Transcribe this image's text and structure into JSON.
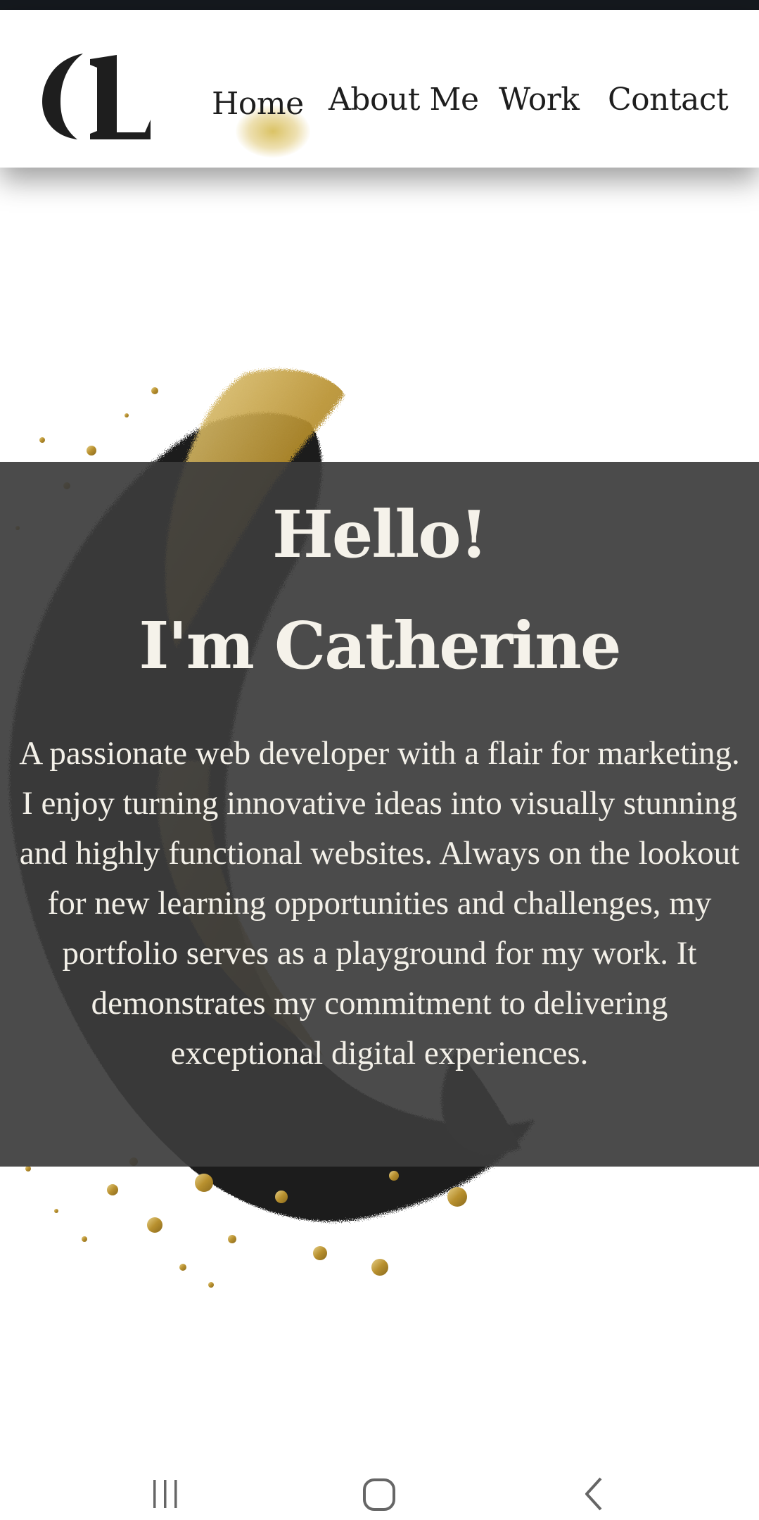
{
  "header": {
    "logo_text": "CL",
    "nav": {
      "home": "Home",
      "about": "About Me",
      "work": "Work",
      "contact": "Contact"
    },
    "active_item": "Home",
    "accent_color": "#d4b84a"
  },
  "hero": {
    "title_line1": "Hello!",
    "title_line2": "I'm Catherine",
    "description": "A passionate web developer with a flair for marketing. I enjoy turning innovative ideas into visually stunning and highly functional websites. Always on the lookout for new learning opportunities and challenges, my portfolio serves as a playground for my work. It demonstrates my commitment to delivering exceptional digital experiences."
  },
  "system_nav": {
    "buttons": [
      "recents-icon",
      "home-icon",
      "back-icon"
    ]
  },
  "colors": {
    "band": "#3c3c3c",
    "text_light": "#f5f2ea",
    "gold": "#c9a43a",
    "ink": "#1e1e1e"
  }
}
